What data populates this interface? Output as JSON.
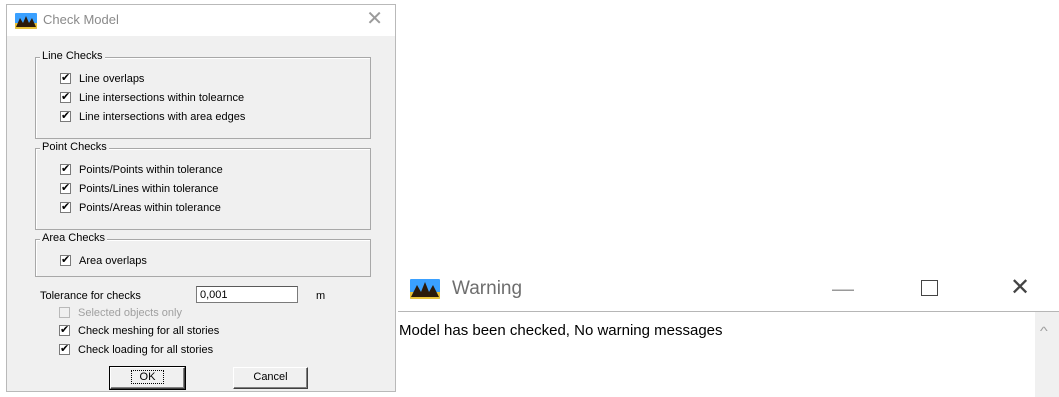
{
  "check_model": {
    "title": "Check Model",
    "close_symbol": "✕",
    "line_checks": {
      "legend": "Line Checks",
      "items": [
        {
          "label": "Line overlaps",
          "checked": true
        },
        {
          "label": "Line intersections within tolearnce",
          "checked": true
        },
        {
          "label": "Line intersections with area edges",
          "checked": true
        }
      ]
    },
    "point_checks": {
      "legend": "Point Checks",
      "items": [
        {
          "label": "Points/Points within tolerance",
          "checked": true
        },
        {
          "label": "Points/Lines within tolerance",
          "checked": true
        },
        {
          "label": "Points/Areas within tolerance",
          "checked": true
        }
      ]
    },
    "area_checks": {
      "legend": "Area Checks",
      "items": [
        {
          "label": "Area overlaps",
          "checked": true
        }
      ]
    },
    "tolerance": {
      "label": "Tolerance for checks",
      "value": "0,001",
      "unit": "m"
    },
    "options": [
      {
        "label": "Selected objects only",
        "checked": false,
        "disabled": true
      },
      {
        "label": "Check meshing for all stories",
        "checked": true,
        "disabled": false
      },
      {
        "label": "Check loading for all stories",
        "checked": true,
        "disabled": false
      }
    ],
    "ok_label": "OK",
    "cancel_label": "Cancel"
  },
  "warning": {
    "title": "Warning",
    "minimize_symbol": "—",
    "close_symbol": "✕",
    "message": "Model has been checked, No warning messages",
    "scroll_up_symbol": "^"
  },
  "icons": {
    "app_icon": "etabs-app-icon"
  },
  "colors": {
    "dialog_bg": "#f0f0f0",
    "icon_sky": "#1e90ff",
    "icon_ground": "#5a3a1a"
  }
}
